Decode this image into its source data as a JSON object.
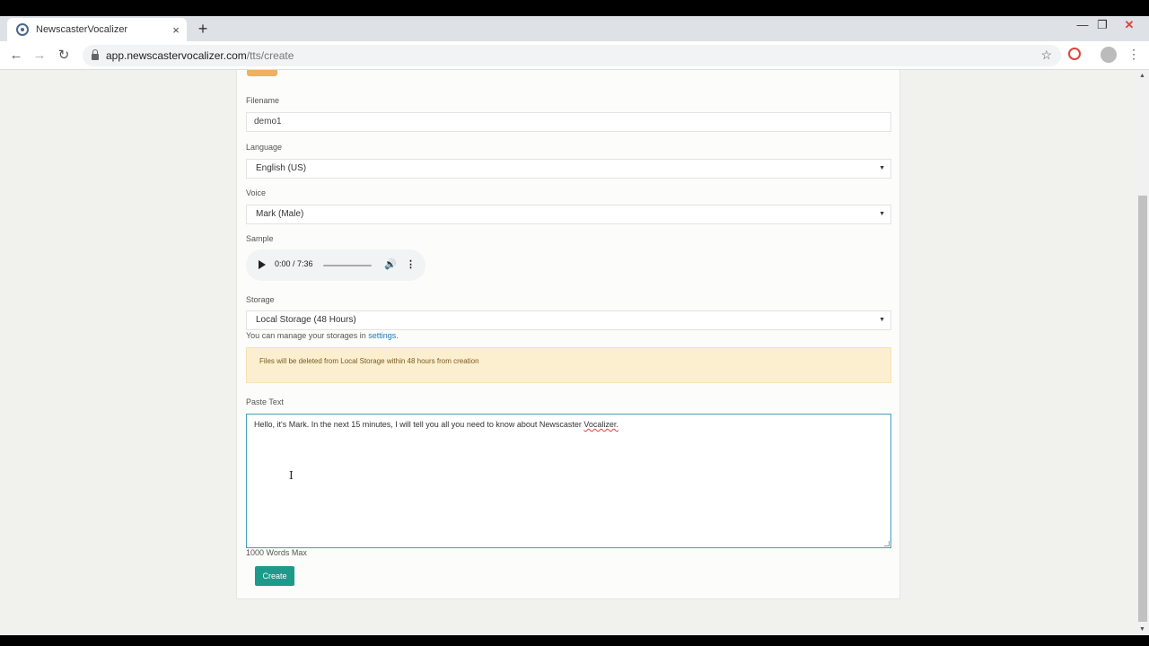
{
  "browser": {
    "tab_title": "NewscasterVocalizer",
    "tab_close": "×",
    "new_tab": "+",
    "url_host": "app.newscastervocalizer.com",
    "url_path": "/tts/create",
    "controls": {
      "minimize": "—",
      "maximize": "❐",
      "close": "✕"
    },
    "nav": {
      "back": "←",
      "forward": "→",
      "reload": "↻"
    },
    "star": "☆",
    "menu": "⋮"
  },
  "form": {
    "filename_label": "Filename",
    "filename_value": "demo1",
    "language_label": "Language",
    "language_value": "English (US)",
    "voice_label": "Voice",
    "voice_value": "Mark (Male)",
    "sample_label": "Sample",
    "sample_time": "0:00 / 7:36",
    "storage_label": "Storage",
    "storage_value": "Local Storage (48 Hours)",
    "storage_help_prefix": "You can manage your storages in ",
    "storage_help_link": "settings",
    "storage_help_suffix": ".",
    "alert_text": "Files will be deleted from Local Storage within 48 hours from creation",
    "paste_label": "Paste Text",
    "paste_text_main": "Hello, it's Mark. In the next 15 minutes, I will tell you all you need to know about Newscaster ",
    "paste_text_misspelled": "Vocalizer.",
    "word_limit": "1000 Words Max",
    "create_label": "Create"
  },
  "colors": {
    "accent": "#1e9a8a",
    "alert_bg": "#fcefcf",
    "link": "#1b7ac0"
  }
}
